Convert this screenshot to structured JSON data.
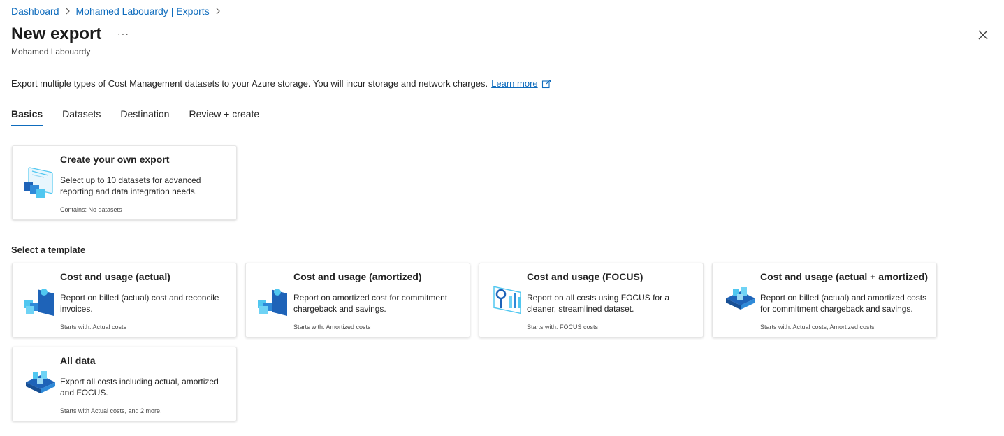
{
  "breadcrumb": {
    "items": [
      "Dashboard",
      "Mohamed Labouardy | Exports"
    ]
  },
  "page": {
    "title": "New export",
    "more": "···",
    "subtitle": "Mohamed Labouardy",
    "description": "Export multiple types of Cost Management datasets to your Azure storage. You will incur storage and network charges.",
    "learn_more": "Learn more"
  },
  "tabs": [
    "Basics",
    "Datasets",
    "Destination",
    "Review + create"
  ],
  "active_tab": "Basics",
  "custom_card": {
    "title": "Create your own export",
    "description": "Select up to 10 datasets for advanced reporting and data integration needs.",
    "footer": "Contains: No datasets",
    "icon": "custom-export-icon"
  },
  "section_title": "Select a template",
  "templates": [
    {
      "title": "Cost and usage (actual)",
      "description": "Report on billed (actual) cost and reconcile invoices.",
      "footer": "Starts with: Actual costs",
      "icon": "actual-cost-icon"
    },
    {
      "title": "Cost and usage (amortized)",
      "description": "Report on amortized cost for commitment chargeback and savings.",
      "footer": "Starts with: Amortized costs",
      "icon": "amortized-cost-icon"
    },
    {
      "title": "Cost and usage (FOCUS)",
      "description": "Report on all costs using FOCUS for a cleaner, streamlined dataset.",
      "footer": "Starts with: FOCUS costs",
      "icon": "focus-cost-icon"
    },
    {
      "title": "Cost and usage (actual + amortized)",
      "description": "Report on billed (actual) and amortized costs for commitment chargeback and savings.",
      "footer": "Starts with: Actual costs, Amortized costs",
      "icon": "actual-amortized-icon"
    },
    {
      "title": "All data",
      "description": "Export all costs including actual, amortized and FOCUS.",
      "footer": "Starts with Actual costs, and 2 more.",
      "icon": "all-data-icon"
    }
  ],
  "colors": {
    "accent": "#0f6cbd",
    "icon_blue": "#50c7f0",
    "icon_dark": "#1e63b8"
  }
}
